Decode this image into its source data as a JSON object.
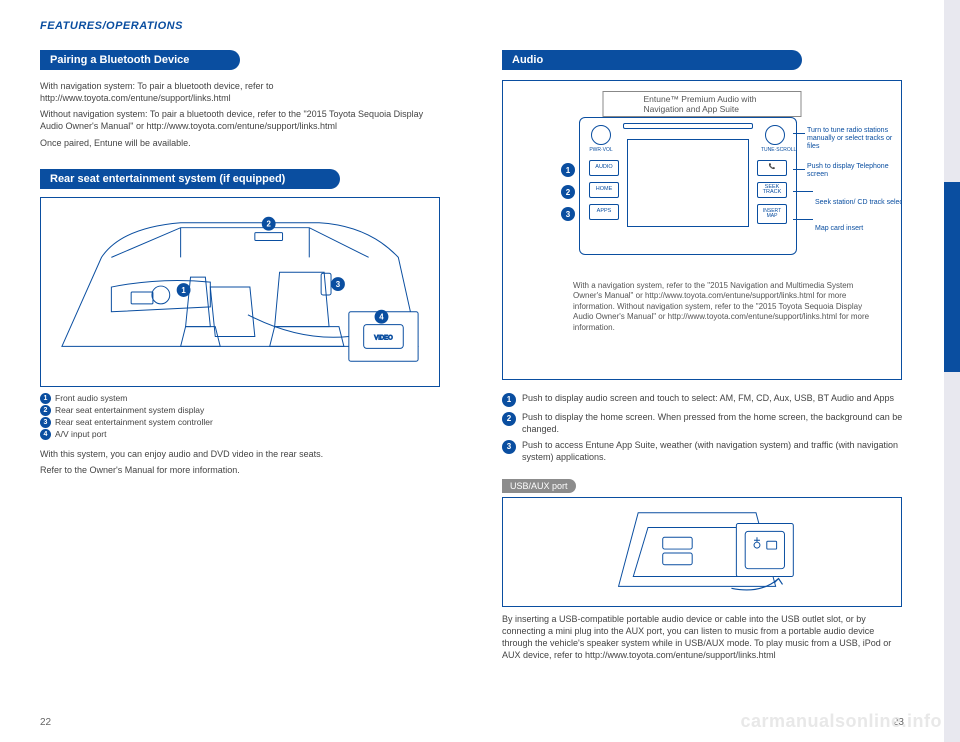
{
  "header": "FEATURES/OPERATIONS",
  "bluetooth": {
    "banner": "Pairing a Bluetooth Device",
    "p1": "With navigation system: To pair a bluetooth device, refer to http://www.toyota.com/entune/support/links.html",
    "p2": "Without navigation system: To pair a bluetooth device, refer to the \"2015 Toyota Sequoia Display Audio Owner's Manual\" or http://www.toyota.com/entune/support/links.html",
    "p3": "Once paired, Entune will be available."
  },
  "rear": {
    "banner": "Rear seat entertainment system (if equipped)",
    "legend": [
      "Front audio system",
      "Rear seat entertainment system display",
      "Rear seat entertainment system controller",
      "A/V input port"
    ],
    "p1": "With this system, you can enjoy audio and DVD video in the rear seats.",
    "p2": "Refer to the Owner's Manual for more information."
  },
  "audio": {
    "banner": "Audio",
    "caption": "Entune™ Premium Audio with Navigation and App Suite",
    "knob_left": "PWR·VOL",
    "knob_right": "TUNE·SCROLL",
    "buttons_left": [
      "AUDIO",
      "HOME",
      "APPS"
    ],
    "buttons_right": [
      "📞",
      "SEEK TRACK",
      "INSERT MAP"
    ],
    "callouts": {
      "tune": "Turn to tune radio stations manually or select tracks or files",
      "phone": "Push to display Telephone screen",
      "seek": "Seek station/ CD track select",
      "map": "Map card insert"
    },
    "legend": [
      "Push to display audio screen and touch to select: AM, FM, CD, Aux, USB, BT Audio and Apps",
      "Push to display the home screen. When pressed from the home screen, the background can be changed.",
      "Push to access Entune App Suite, weather (with navigation system) and traffic (with navigation system) applications."
    ],
    "bottom_text": "With a navigation system, refer to the \"2015 Navigation and Multimedia System Owner's Manual\" or http://www.toyota.com/entune/support/links.html for more information. Without navigation system, refer to the \"2015 Toyota Sequoia Display Audio Owner's Manual\" or http://www.toyota.com/entune/support/links.html for more information."
  },
  "usb": {
    "banner": "USB/AUX port",
    "p1": "By inserting a USB-compatible portable audio device or cable into the USB outlet slot, or by connecting a mini plug into the AUX port, you can listen to music from a portable audio device through the vehicle's speaker system while in USB/AUX mode. To play music from a USB, iPod or AUX device, refer to http://www.toyota.com/entune/support/links.html"
  },
  "page_left": "22",
  "page_right": "23",
  "watermark": "carmanualsonline.info"
}
